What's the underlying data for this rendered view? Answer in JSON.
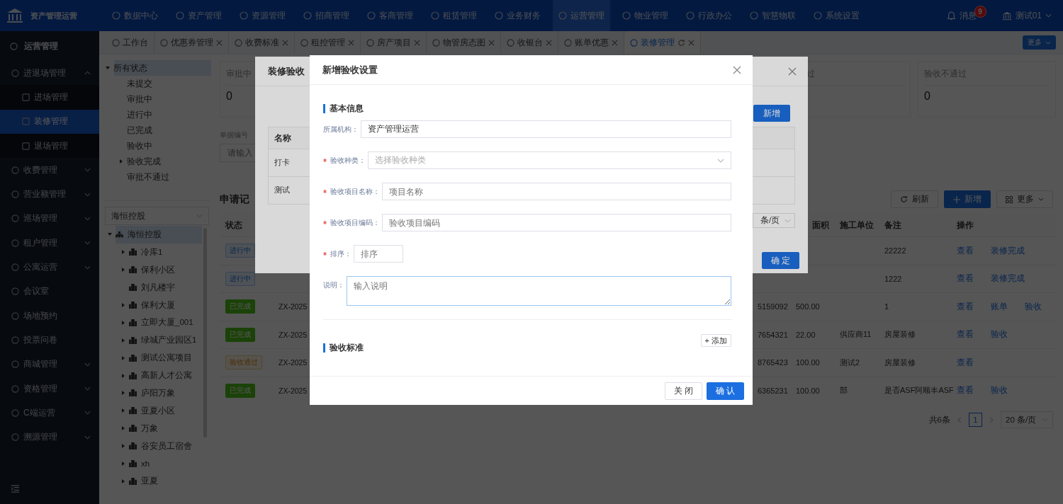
{
  "top_bar": {
    "app_name": "资产管理运营",
    "nav": [
      {
        "label": "数据中心",
        "selected": false
      },
      {
        "label": "资产管理",
        "selected": false
      },
      {
        "label": "资源管理",
        "selected": false
      },
      {
        "label": "招商管理",
        "selected": false
      },
      {
        "label": "客商管理",
        "selected": false
      },
      {
        "label": "租赁管理",
        "selected": false
      },
      {
        "label": "业务财务",
        "selected": false
      },
      {
        "label": "运营管理",
        "selected": true
      },
      {
        "label": "物业管理",
        "selected": false
      },
      {
        "label": "行政办公",
        "selected": false
      },
      {
        "label": "智慧物联",
        "selected": false
      },
      {
        "label": "系统设置",
        "selected": false
      }
    ],
    "messages": {
      "label": "消息",
      "badge": "9"
    },
    "user": "测试01"
  },
  "sidebar": {
    "title": "运营管理",
    "items": [
      {
        "label": "进退场管理",
        "kind": "group",
        "expanded": true,
        "selected": false,
        "children": [
          {
            "label": "进场管理",
            "selected": false
          },
          {
            "label": "装修管理",
            "selected": true
          },
          {
            "label": "退场管理",
            "selected": false
          }
        ]
      },
      {
        "label": "收费管理",
        "kind": "group",
        "expanded": false,
        "selected": false
      },
      {
        "label": "营业额管理",
        "kind": "group",
        "expanded": false,
        "selected": false
      },
      {
        "label": "巡场管理",
        "kind": "group",
        "expanded": false,
        "selected": false
      },
      {
        "label": "租户管理",
        "kind": "group",
        "expanded": false,
        "selected": false
      },
      {
        "label": "公寓运营",
        "kind": "group",
        "expanded": false,
        "selected": false
      },
      {
        "label": "会议室",
        "kind": "link",
        "selected": false
      },
      {
        "label": "场地预约",
        "kind": "link",
        "selected": false
      },
      {
        "label": "投票问卷",
        "kind": "link",
        "selected": false
      },
      {
        "label": "商城管理",
        "kind": "group",
        "expanded": false,
        "selected": false
      },
      {
        "label": "资格管理",
        "kind": "group",
        "expanded": false,
        "selected": false
      },
      {
        "label": "C端运营",
        "kind": "group",
        "expanded": false,
        "selected": false
      },
      {
        "label": "溯源管理",
        "kind": "group",
        "expanded": false,
        "selected": false
      }
    ]
  },
  "tabs": [
    {
      "label": "工作台",
      "selected": false,
      "closable": false
    },
    {
      "label": "优惠券管理",
      "selected": false,
      "closable": true
    },
    {
      "label": "收费标准",
      "selected": false,
      "closable": true
    },
    {
      "label": "租控管理",
      "selected": false,
      "closable": true
    },
    {
      "label": "房产项目",
      "selected": false,
      "closable": true
    },
    {
      "label": "物管房态图",
      "selected": false,
      "closable": true
    },
    {
      "label": "收银台",
      "selected": false,
      "closable": true
    },
    {
      "label": "账单优惠",
      "selected": false,
      "closable": true
    },
    {
      "label": "装修管理",
      "selected": true,
      "closable": true
    }
  ],
  "tabs_more": "更多",
  "status_tree": {
    "label": "所有状态",
    "selected": true,
    "expanded": true,
    "children": [
      {
        "label": "未提交",
        "kind": "leaf"
      },
      {
        "label": "审批中",
        "kind": "leaf"
      },
      {
        "label": "进行中",
        "kind": "leaf"
      },
      {
        "label": "已完成",
        "kind": "leaf"
      },
      {
        "label": "验收中",
        "kind": "leaf"
      },
      {
        "label": "验收完成",
        "kind": "branch",
        "expanded": false
      },
      {
        "label": "审批不通过",
        "kind": "leaf"
      }
    ]
  },
  "org_select": "海恒控股",
  "org_tree": {
    "label": "海恒控股",
    "selected": true,
    "expanded": true,
    "children": [
      {
        "label": "冷库1",
        "kind": "branch",
        "expanded": false
      },
      {
        "label": "保利小区",
        "kind": "branch",
        "expanded": false
      },
      {
        "label": "刘凡楼宇",
        "kind": "leaf"
      },
      {
        "label": "保利大厦",
        "kind": "branch",
        "expanded": false
      },
      {
        "label": "立即大厦_001",
        "kind": "branch",
        "expanded": false
      },
      {
        "label": "绿城产业园区1",
        "kind": "branch",
        "expanded": false
      },
      {
        "label": "测试公寓项目",
        "kind": "branch",
        "expanded": false
      },
      {
        "label": "高新人才公寓",
        "kind": "branch",
        "expanded": false
      },
      {
        "label": "庐阳万象",
        "kind": "branch",
        "expanded": false
      },
      {
        "label": "亚夏小区",
        "kind": "branch",
        "expanded": false
      },
      {
        "label": "万象",
        "kind": "branch",
        "expanded": false
      },
      {
        "label": "谷安员工宿舍",
        "kind": "branch",
        "expanded": false
      },
      {
        "label": "xh",
        "kind": "branch",
        "expanded": false
      },
      {
        "label": "亚夏",
        "kind": "branch",
        "expanded": false
      }
    ]
  },
  "stats": [
    {
      "label": "审批中",
      "value": "0"
    },
    {
      "label": "过"
    },
    {
      "label": "验收不通过",
      "value": "0"
    }
  ],
  "filter": {
    "label": "单据编号",
    "placeholder": "请输入"
  },
  "records": {
    "title": "申请记",
    "refresh": "刷新",
    "add": "新增",
    "more": "更多",
    "columns": [
      {
        "label": "状态"
      },
      {
        "label": "面积"
      },
      {
        "label": "施工单位"
      },
      {
        "label": "备注"
      },
      {
        "label": "操作"
      }
    ],
    "rows": [
      {
        "status": {
          "label": "进行中",
          "kind": "progress"
        },
        "note": "22222",
        "actions": [
          "查看",
          "装修完成"
        ]
      },
      {
        "status": {
          "label": "进行中",
          "kind": "progress"
        },
        "note": "1222",
        "actions": [
          "查看",
          "装修完成"
        ]
      },
      {
        "status": {
          "label": "已完成",
          "kind": "done"
        },
        "code": "ZX-2025",
        "phone": "5159092",
        "area": "500.00",
        "note": "1",
        "actions": [
          "查看",
          "账单",
          "验收"
        ]
      },
      {
        "status": {
          "label": "已完成",
          "kind": "done"
        },
        "code": "ZX-2025",
        "phone": "7654321",
        "area": "22.00",
        "builder": "供应商11",
        "note": "房屋装修",
        "actions": [
          "查看",
          "验收"
        ]
      },
      {
        "status": {
          "label": "验收通过",
          "kind": "passed"
        },
        "code": "ZX-2025",
        "phone": "8765423",
        "area": "100.00",
        "builder": "测试2",
        "note": "房屋装修",
        "actions": [
          "查看"
        ]
      },
      {
        "status": {
          "label": "已完成",
          "kind": "done"
        },
        "code": "ZX-2025",
        "phone": "6365231",
        "area": "100.00",
        "builder": "部",
        "note": "是否ASF阿顺丰ASF",
        "actions": [
          "查看",
          "验收"
        ]
      }
    ],
    "pagination": {
      "total": "共6条",
      "pages": [
        {
          "label": "1",
          "selected": true
        }
      ],
      "page_size": "20 条/页"
    }
  },
  "settings_dialog": {
    "title": "装修验收",
    "add": "新增",
    "columns": [
      "名称"
    ],
    "rows": [
      [
        "打卡"
      ],
      [
        "测试"
      ]
    ],
    "page_size": "条/页",
    "confirm": "确 定"
  },
  "new_dialog": {
    "title": "新增验收设置",
    "section_basic": "基本信息",
    "fields": [
      {
        "label": "所属机构：",
        "required": false,
        "kind": "input",
        "value": "资产管理运营"
      },
      {
        "label": "验收种类：",
        "required": true,
        "kind": "select",
        "placeholder": "选择验收种类"
      },
      {
        "label": "验收项目名称：",
        "required": true,
        "kind": "input",
        "placeholder": "项目名称"
      },
      {
        "label": "验收项目编码：",
        "required": true,
        "kind": "input",
        "placeholder": "验收项目编码"
      },
      {
        "label": "排序：",
        "required": true,
        "kind": "short",
        "placeholder": "排序"
      },
      {
        "label": "说明：",
        "required": false,
        "kind": "textarea",
        "placeholder": "输入说明"
      }
    ],
    "section_standard": "验收标准",
    "add": "+ 添加",
    "close": "关 闭",
    "confirm": "确 认"
  }
}
